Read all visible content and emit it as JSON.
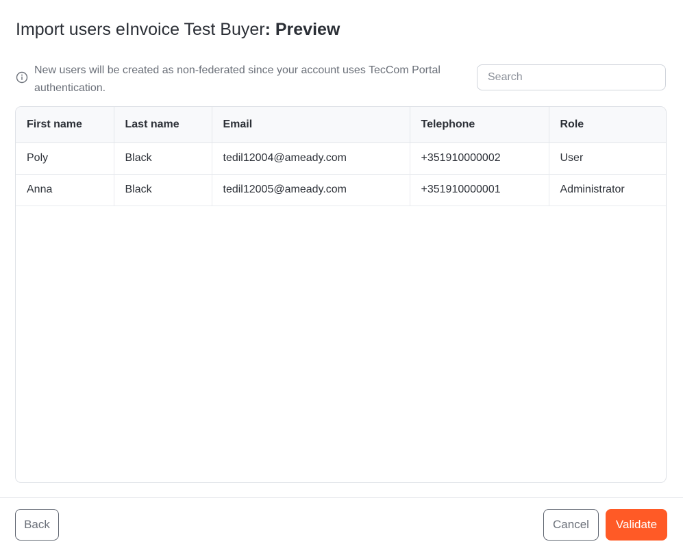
{
  "dialog": {
    "title": "Import users eInvoice Test Buyer",
    "title_separator": ":",
    "subtitle": "Preview",
    "info_text": "New users will be created as non-federated since your account uses TecCom Portal authentication.",
    "info_icon": "info-circle-icon"
  },
  "search": {
    "placeholder": "Search",
    "value": ""
  },
  "table": {
    "columns": [
      "First name",
      "Last name",
      "Email",
      "Telephone",
      "Role"
    ],
    "rows": [
      {
        "first_name": "Poly",
        "last_name": "Black",
        "email": "tedil12004@ameady.com",
        "telephone": "+351910000002",
        "role": "User"
      },
      {
        "first_name": "Anna",
        "last_name": "Black",
        "email": "tedil12005@ameady.com",
        "telephone": "+351910000001",
        "role": "Administrator"
      }
    ]
  },
  "footer": {
    "back_label": "Back",
    "cancel_label": "Cancel",
    "validate_label": "Validate"
  },
  "colors": {
    "primary": "#ff5a26",
    "text": "#2d3138",
    "muted": "#6b7079",
    "border": "#dfe2e7",
    "header_bg": "#f8f9fb"
  }
}
